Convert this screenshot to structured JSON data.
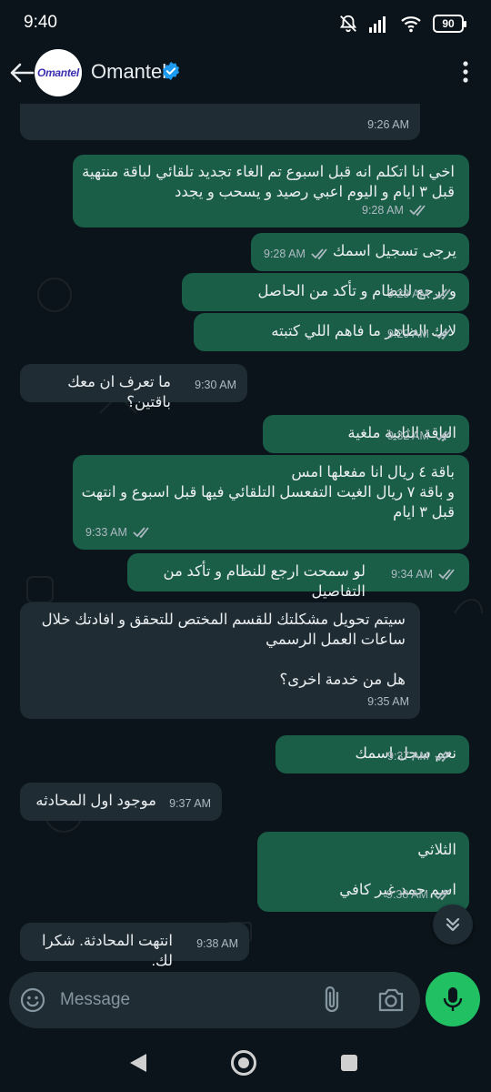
{
  "status_bar": {
    "time": "9:40",
    "battery": "90"
  },
  "header": {
    "contact_name": "Omantel",
    "avatar_text": "Omantel"
  },
  "messages": [
    {
      "dir": "in",
      "text": "",
      "time": "9:26 AM"
    },
    {
      "dir": "out",
      "text": "اخي انا اتكلم انه قبل اسبوع تم الغاء تجديد تلقائي لباقة منتهية قبل ٣ ايام و اليوم اعبي رصيد و يسحب و يجدد",
      "time": "9:28 AM"
    },
    {
      "dir": "out",
      "text": "يرجى تسجيل اسمك",
      "time": "9:28 AM"
    },
    {
      "dir": "out",
      "text": "و ارجع للنظام و تأكد من الحاصل",
      "time": "9:29 AM"
    },
    {
      "dir": "out",
      "text": "لانك الظاهر ما فاهم اللي كتبته",
      "time": "9:29 AM"
    },
    {
      "dir": "in",
      "text": "ما تعرف ان معك باقتين؟",
      "time": "9:30 AM"
    },
    {
      "dir": "out",
      "text": "الباقة الثانية ملغية",
      "time": "9:32 AM"
    },
    {
      "dir": "out",
      "text": "باقة ٤ ريال انا مفعلها امس\nو باقة ٧ ريال الغيت التفعسل التلقائي فيها قبل اسبوع و انتهت قبل ٣ ايام",
      "time": "9:33 AM"
    },
    {
      "dir": "out",
      "text": "لو سمحت ارجع للنظام و تأكد من التفاصيل",
      "time": "9:34 AM"
    },
    {
      "dir": "in",
      "text": "سيتم تحويل مشكلتك للقسم المختص للتحقق و افادتك خلال ساعات العمل الرسمي\n\nهل من خدمة اخرى؟",
      "time": "9:35 AM"
    },
    {
      "dir": "out",
      "text": "نعم سجل اسمك",
      "time": "9:37 AM"
    },
    {
      "dir": "in",
      "text": "موجود اول المحادثه",
      "time": "9:37 AM"
    },
    {
      "dir": "out",
      "text": "الثلاثي\n\nاسم حمد غير كافي",
      "time": "9:38 AM"
    },
    {
      "dir": "in",
      "text": "انتهت المحادثة. شكرا لك.",
      "time": "9:38 AM"
    }
  ],
  "composer": {
    "placeholder": "Message"
  },
  "colors": {
    "accent_green": "#21c063",
    "verified_blue": "#1d9bf0",
    "outgoing_bubble": "#1a5e48",
    "incoming_bubble": "#1f2c34",
    "tick_color": "#aebac1"
  }
}
